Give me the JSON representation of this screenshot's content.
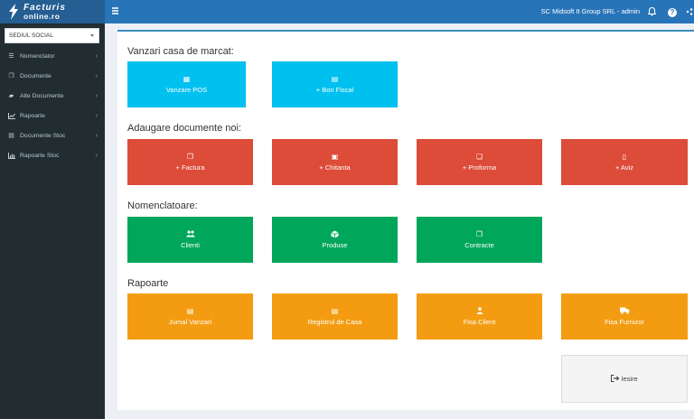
{
  "header": {
    "logo_line1": "Facturis",
    "logo_line2": "online.ro",
    "user": "SC Midsoft It Group SRL - admin",
    "icons": [
      "menu-icon",
      "bell-icon",
      "help-icon",
      "share-icon"
    ]
  },
  "sidebar": {
    "company_select": "SEDIUL SOCIAL",
    "items": [
      {
        "label": "Nomenclator",
        "icon": "list-icon"
      },
      {
        "label": "Documente",
        "icon": "copy-icon"
      },
      {
        "label": "Alte Documente",
        "icon": "folder-icon"
      },
      {
        "label": "Rapoarte",
        "icon": "line-chart-icon"
      },
      {
        "label": "Documente Stoc",
        "icon": "document-icon"
      },
      {
        "label": "Rapoarte Stoc",
        "icon": "bar-chart-icon"
      }
    ]
  },
  "sections": [
    {
      "title": "Vanzari casa de marcat:",
      "tiles": [
        {
          "label": "Vanzare POS",
          "icon": "calculator-icon",
          "color": "#00c0ef"
        },
        {
          "label": "+ Bon Fiscal",
          "icon": "file-text-icon",
          "color": "#00c0ef"
        }
      ]
    },
    {
      "title": "Adaugare documente noi:",
      "tiles": [
        {
          "label": "+ Factura",
          "icon": "copy-icon",
          "color": "#dd4b39"
        },
        {
          "label": "+ Chitanta",
          "icon": "briefcase-icon",
          "color": "#dd4b39"
        },
        {
          "label": "+ Proforma",
          "icon": "files-icon",
          "color": "#dd4b39"
        },
        {
          "label": "+ Aviz",
          "icon": "file-icon",
          "color": "#dd4b39"
        }
      ]
    },
    {
      "title": "Nomenclatoare:",
      "tiles": [
        {
          "label": "Clienti",
          "icon": "users-icon",
          "color": "#00a65a"
        },
        {
          "label": "Produse",
          "icon": "cube-icon",
          "color": "#00a65a"
        },
        {
          "label": "Contracte",
          "icon": "copy-icon",
          "color": "#00a65a"
        }
      ]
    },
    {
      "title": "Rapoarte",
      "tiles": [
        {
          "label": "Jurnal Vanzari",
          "icon": "id-card-icon",
          "color": "#f39c12"
        },
        {
          "label": "Registrul de Casa",
          "icon": "id-card-icon",
          "color": "#f39c12"
        },
        {
          "label": "Fisa Client",
          "icon": "user-icon",
          "color": "#f39c12"
        },
        {
          "label": "Fisa Furnizor",
          "icon": "truck-icon",
          "color": "#f39c12"
        }
      ]
    }
  ],
  "exit_button": {
    "label": "Iesire",
    "icon": "sign-out-icon"
  }
}
